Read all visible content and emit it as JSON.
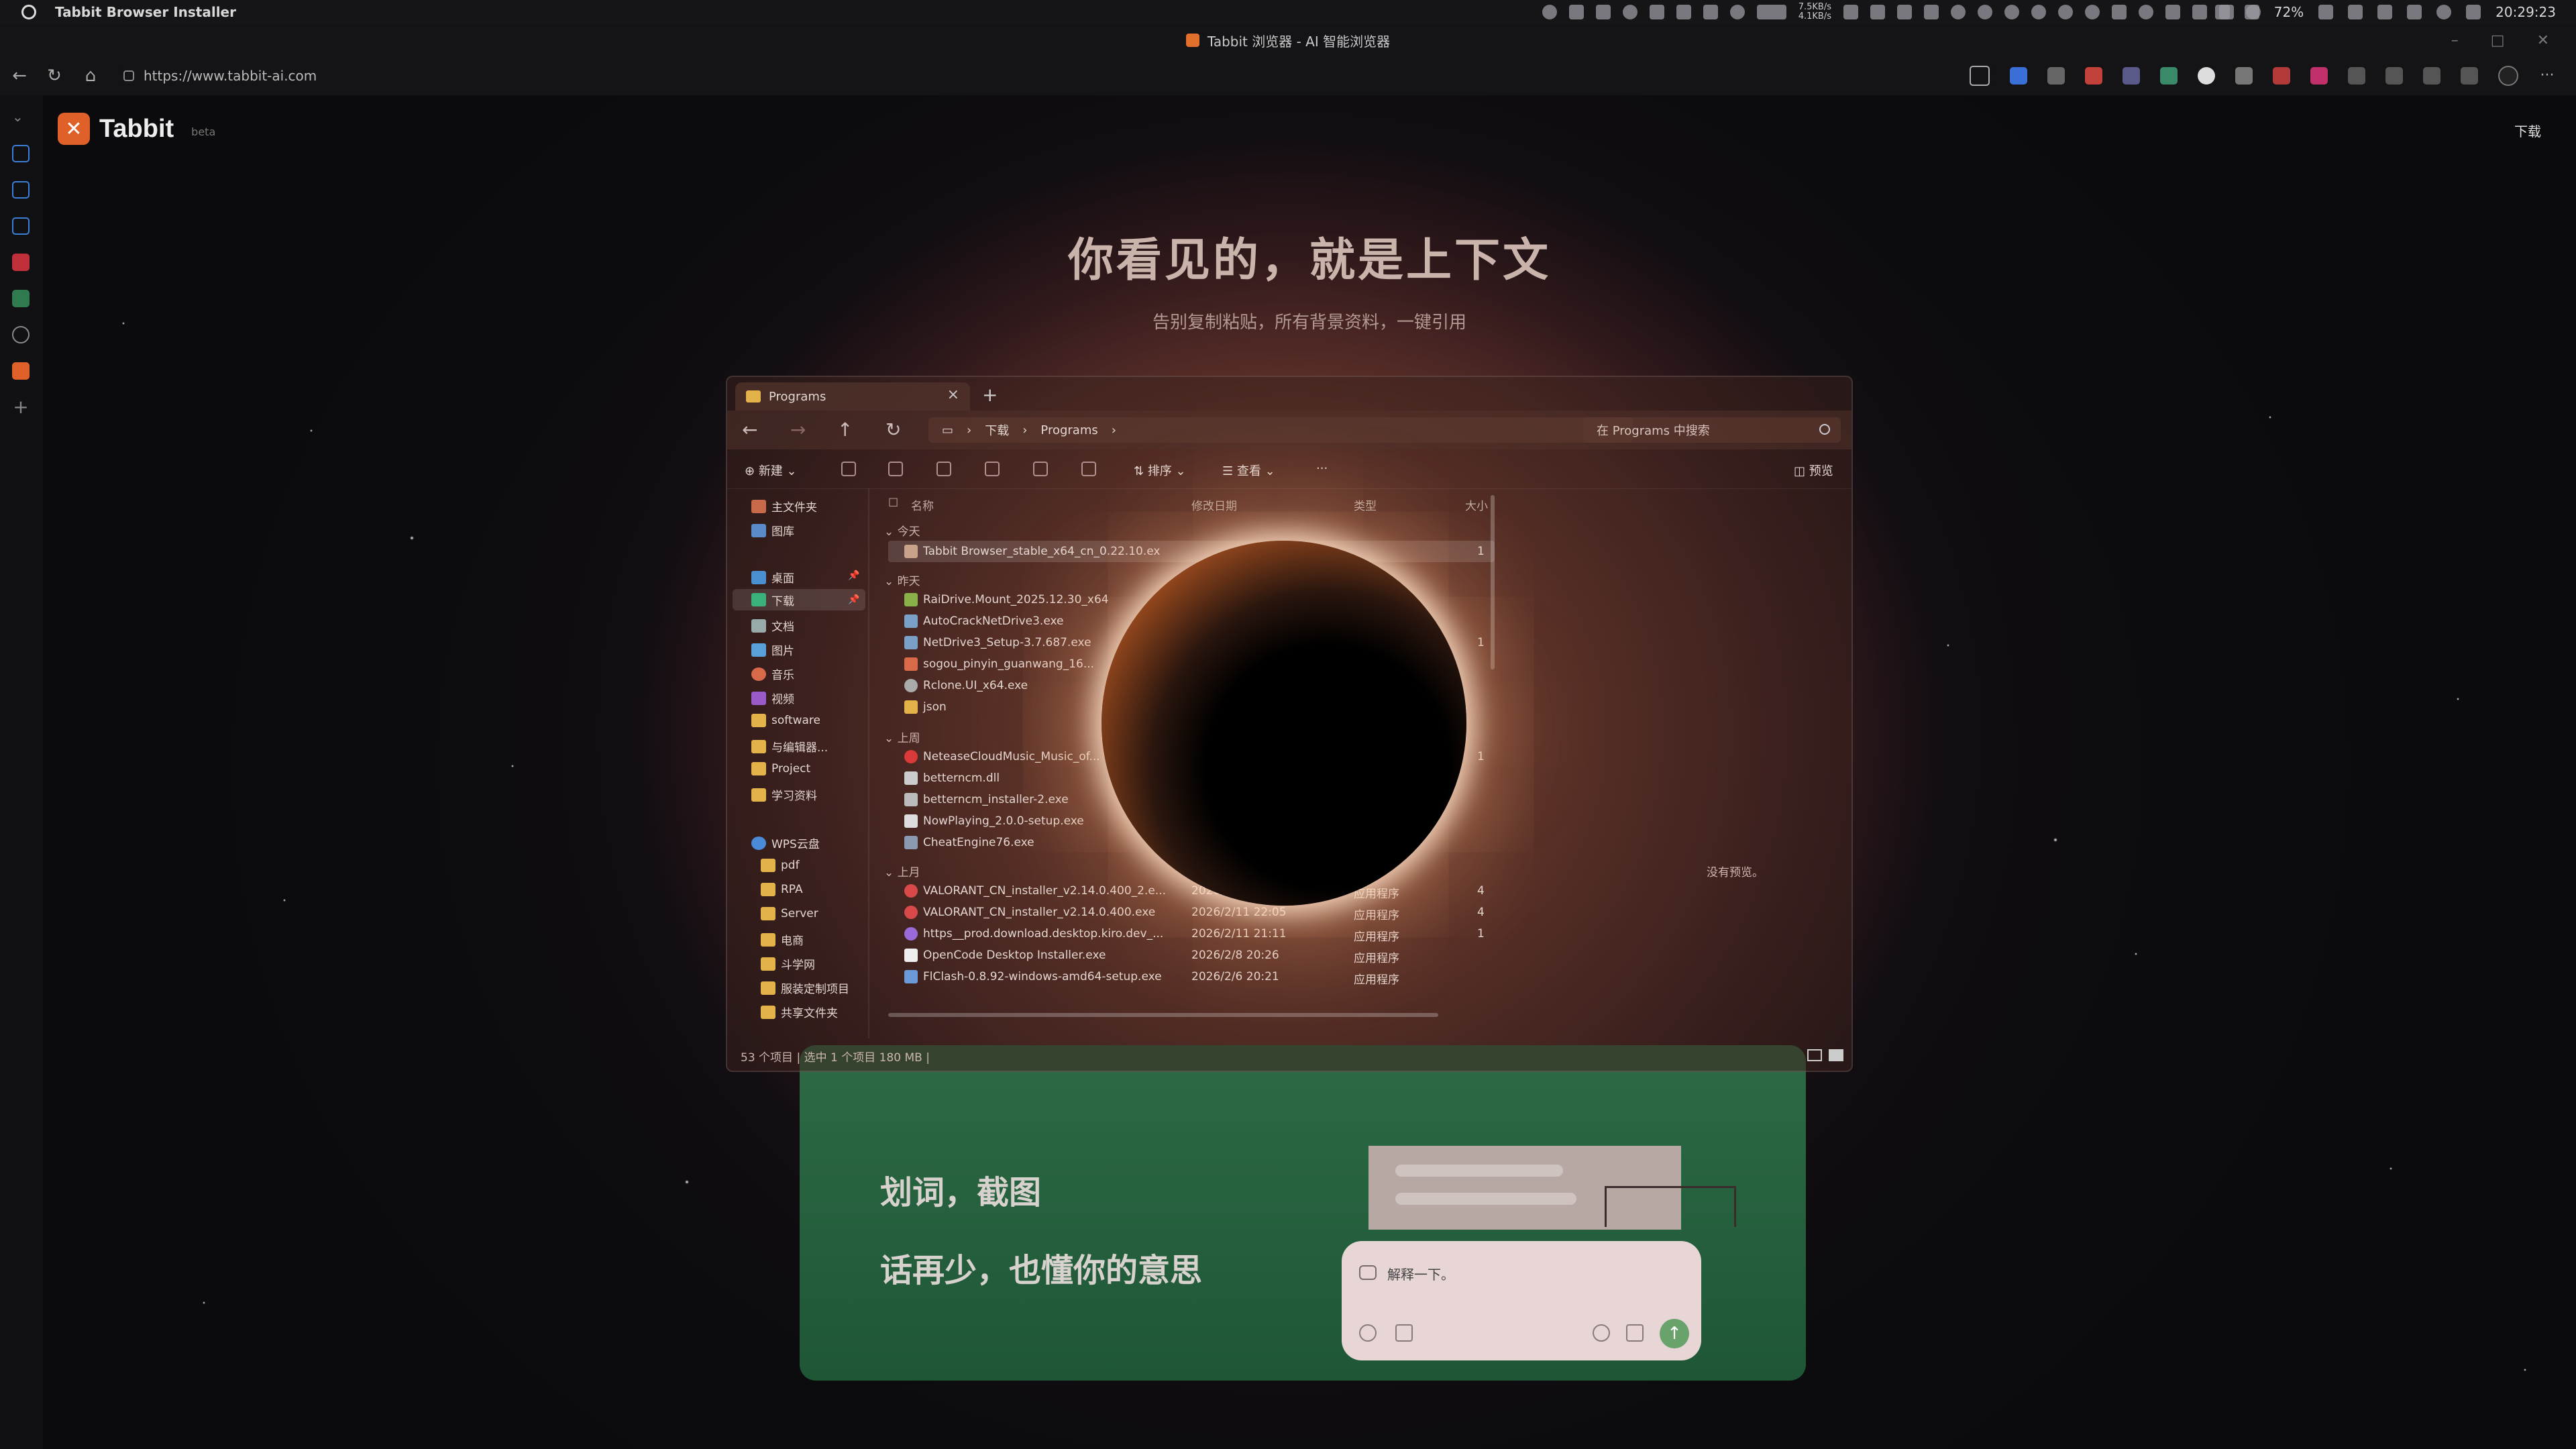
{
  "os_bar": {
    "title": "Tabbit Browser Installer",
    "net_up": "7.5KB/s",
    "net_down": "4.1KB/s",
    "battery": "72%",
    "time": "20:29:23"
  },
  "browser": {
    "tab_title": "Tabbit 浏览器 - AI 智能浏览器",
    "url": "https://www.tabbit-ai.com"
  },
  "site": {
    "brand": "Tabbit",
    "beta": "beta",
    "download_label": "下载",
    "headline": "你看见的，就是上下文",
    "subline": "告别复制粘贴，所有背景资料，一键引用",
    "feature_1": "划词，截图",
    "feature_2": "话再少，也懂你的意思",
    "chat_prompt": "解释一下。"
  },
  "explorer": {
    "tab_label": "Programs",
    "breadcrumb": [
      "下载",
      "Programs"
    ],
    "search_placeholder": "在 Programs 中搜索",
    "toolbar": {
      "new": "新建",
      "sort": "排序",
      "view": "查看",
      "more": "···",
      "preview": "预览"
    },
    "nav_items": [
      {
        "label": "主文件夹"
      },
      {
        "label": "图库"
      },
      {
        "label": "桌面"
      },
      {
        "label": "下载"
      },
      {
        "label": "文档"
      },
      {
        "label": "图片"
      },
      {
        "label": "音乐"
      },
      {
        "label": "视频"
      },
      {
        "label": "software"
      },
      {
        "label": "与编辑器..."
      },
      {
        "label": "Project"
      },
      {
        "label": "学习资料"
      },
      {
        "label": "WPS云盘"
      },
      {
        "label": "pdf"
      },
      {
        "label": "RPA"
      },
      {
        "label": "Server"
      },
      {
        "label": "电商"
      },
      {
        "label": "斗学网"
      },
      {
        "label": "服装定制项目"
      },
      {
        "label": "共享文件夹"
      }
    ],
    "columns": {
      "name": "名称",
      "date": "修改日期",
      "type": "类型",
      "size": "大小"
    },
    "groups": {
      "today": "今天",
      "yesterday": "昨天",
      "last_week": "上周",
      "last_month": "上月"
    },
    "files_today": [
      {
        "name": "Tabbit Browser_stable_x64_cn_0.22.10.ex",
        "size": "1"
      }
    ],
    "files_yesterday": [
      {
        "name": "RaiDrive.Mount_2025.12.30_x64"
      },
      {
        "name": "AutoCrackNetDrive3.exe"
      },
      {
        "name": "NetDrive3_Setup-3.7.687.exe",
        "size": "1"
      },
      {
        "name": "sogou_pinyin_guanwang_16..."
      },
      {
        "name": "Rclone.UI_x64.exe"
      },
      {
        "name": "json"
      }
    ],
    "files_last_week": [
      {
        "name": "NeteaseCloudMusic_Music_of...",
        "size": "1"
      },
      {
        "name": "betterncm.dll"
      },
      {
        "name": "betterncm_installer-2.exe"
      },
      {
        "name": "NowPlaying_2.0.0-setup.exe"
      },
      {
        "name": "CheatEngine76.exe"
      }
    ],
    "files_last_month": [
      {
        "name": "VALORANT_CN_installer_v2.14.0.400_2.e...",
        "date": "2026/2/21 15:55",
        "type": "应用程序",
        "size": "4"
      },
      {
        "name": "VALORANT_CN_installer_v2.14.0.400.exe",
        "date": "2026/2/11 22:05",
        "type": "应用程序",
        "size": "4"
      },
      {
        "name": "https__prod.download.desktop.kiro.dev_...",
        "date": "2026/2/11 21:11",
        "type": "应用程序",
        "size": "1"
      },
      {
        "name": "OpenCode Desktop Installer.exe",
        "date": "2026/2/8 20:26",
        "type": "应用程序"
      },
      {
        "name": "FlClash-0.8.92-windows-amd64-setup.exe",
        "date": "2026/2/6 20:21",
        "type": "应用程序"
      }
    ],
    "preview_empty": "没有预览。",
    "status": {
      "count": "53 个项目",
      "selected": "选中 1 个项目",
      "size": "180 MB"
    }
  }
}
